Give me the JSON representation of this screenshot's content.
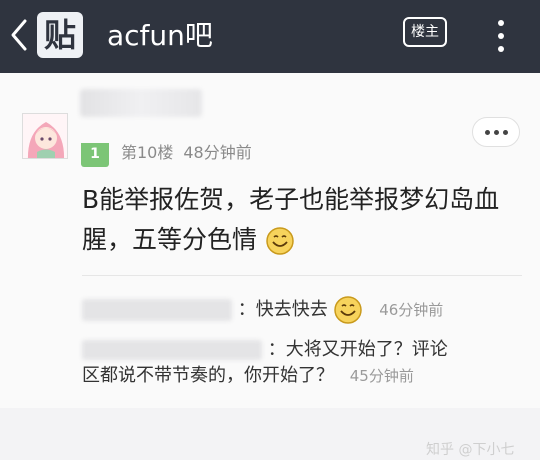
{
  "header": {
    "back_icon": "back-chevron-icon",
    "logo_text": "贴",
    "title": "acfun吧",
    "louzhu_label": "楼主",
    "menu_icon": "vertical-dots-icon"
  },
  "post": {
    "level": "1",
    "floor": "第10楼",
    "time": "48分钟前",
    "content_line1": "B能举报佐贺，老子也能举报梦幻岛血",
    "content_line2": "腥，五等分色情",
    "more_icon": "more-dots-icon"
  },
  "replies": [
    {
      "text": "：快去快去",
      "emoji": "smiley-icon",
      "time": "46分钟前"
    },
    {
      "text_line1": "：大将又开始了？评论",
      "text_line2": "区都说不带节奏的，你开始了？",
      "time": "45分钟前"
    }
  ],
  "watermark": "知乎 @下小七",
  "colors": {
    "topbar": "#2f343f",
    "level_badge": "#7cc576",
    "background": "#fafafa"
  }
}
